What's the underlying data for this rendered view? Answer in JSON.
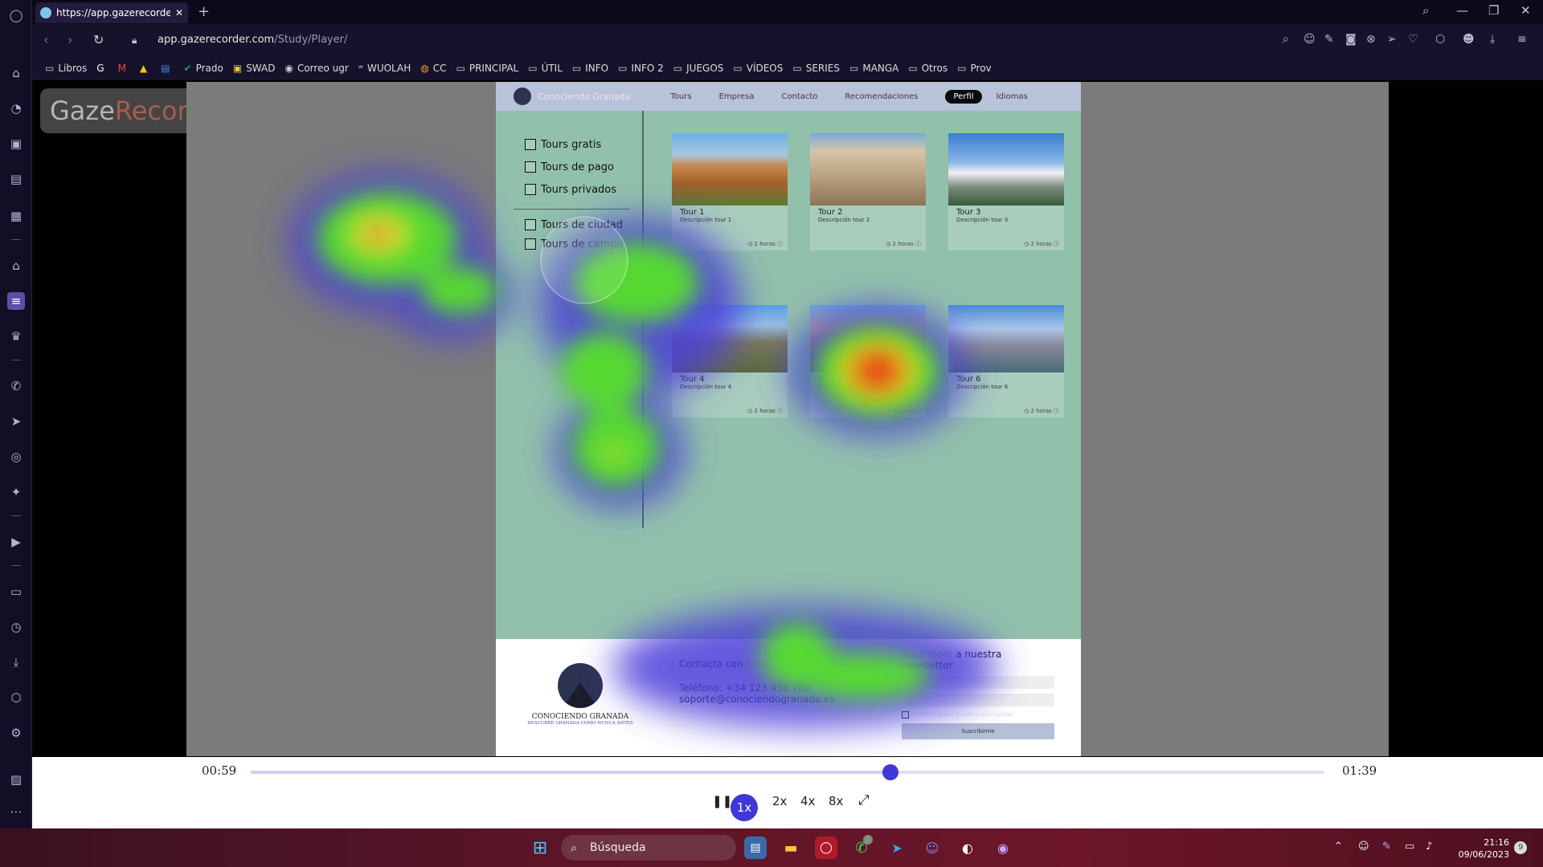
{
  "browser": {
    "tab_title": "https://app.gazerecorder.c",
    "url_domain": "app.gazerecorder.com",
    "url_path": "/Study/Player/",
    "bookmarks": [
      "Libros",
      "Prado",
      "SWAD",
      "Correo ugr",
      "WUOLAH",
      "CC",
      "PRINCIPAL",
      "ÚTIL",
      "INFO",
      "INFO 2",
      "JUEGOS",
      "VÍDEOS",
      "SERIES",
      "MANGA",
      "Otros",
      "Prov"
    ]
  },
  "watermark": {
    "part1": "Gaze",
    "part2": "Recorder"
  },
  "site": {
    "brand": "Conociendo Granada",
    "nav": [
      "Tours",
      "Empresa",
      "Contacto",
      "Recomendaciones",
      "Perfil",
      "Idiomas"
    ],
    "filters": [
      "Tours gratis",
      "Tours de pago",
      "Tours privados",
      "Tours de ciudad",
      "Tours de campo"
    ],
    "tours": [
      {
        "title": "Tour 1",
        "desc": "Descripción tour 1",
        "dur": "2 horas"
      },
      {
        "title": "Tour 2",
        "desc": "Descripción tour 2",
        "dur": "2 horas"
      },
      {
        "title": "Tour 3",
        "desc": "Descripción tour 3",
        "dur": "2 horas"
      },
      {
        "title": "Tour 4",
        "desc": "Descripción tour 4",
        "dur": "2 horas"
      },
      {
        "title": "Tour 5",
        "desc": "Descripción tour 5",
        "dur": "2 horas"
      },
      {
        "title": "Tour 6",
        "desc": "Descripción tour 6",
        "dur": "2 horas"
      }
    ],
    "footer": {
      "logo_name": "CONOCIENDO GRANADA",
      "logo_slogan": "DESCUBRE GRANADA COMO NUNCA ANTES",
      "contact_a": "Contacta con",
      "contact_b": " nosotros",
      "phone": "Teléfono: +34 123 456 789",
      "email": "soporte@conociendogranada.es",
      "news_a": "Suscríbete",
      "news_b": " a nuestra newsletter",
      "privacy": "He leído y acepto la política de privacidad",
      "subscribe": "Suscribirme"
    }
  },
  "player": {
    "current": "00:59",
    "total": "01:39",
    "progress": 0.596,
    "speeds": [
      "1x",
      "2x",
      "4x",
      "8x"
    ],
    "active_speed": "1x"
  },
  "taskbar": {
    "search_placeholder": "Búsqueda",
    "time": "21:16",
    "date": "09/06/2023",
    "notifications": "9",
    "whatsapp_badge": "2"
  },
  "colors": {
    "accent": "#3f38d8",
    "site_bg": "#92c1ab",
    "taskbar": "#5a1527"
  }
}
